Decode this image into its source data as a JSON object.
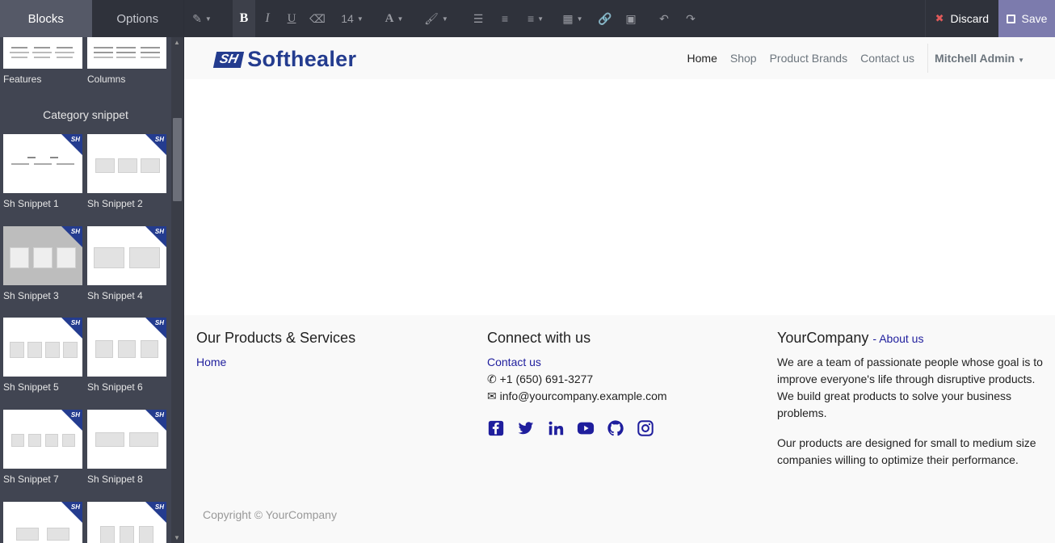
{
  "sidebar": {
    "tabs": [
      {
        "label": "Blocks"
      },
      {
        "label": "Options"
      }
    ],
    "top_items": [
      {
        "label": "Features"
      },
      {
        "label": "Columns"
      }
    ],
    "category_heading": "Category snippet",
    "snippets": [
      {
        "label": "Sh Snippet 1"
      },
      {
        "label": "Sh Snippet 2"
      },
      {
        "label": "Sh Snippet 3"
      },
      {
        "label": "Sh Snippet 4"
      },
      {
        "label": "Sh Snippet 5"
      },
      {
        "label": "Sh Snippet 6"
      },
      {
        "label": "Sh Snippet 7"
      },
      {
        "label": "Sh Snippet 8"
      }
    ]
  },
  "toolbar": {
    "font_size": "14",
    "discard_label": "Discard",
    "save_label": "Save",
    "icons": [
      "magic-wand-icon",
      "bold-icon",
      "italic-icon",
      "underline-icon",
      "eraser-icon",
      "font-size-select",
      "font-color-icon",
      "highlight-brush-icon",
      "bullet-list-icon",
      "numbered-list-icon",
      "align-icon",
      "table-icon",
      "link-icon",
      "image-icon",
      "undo-icon",
      "redo-icon"
    ]
  },
  "navbar": {
    "logo_mark": "SH",
    "logo_text": "Softhealer",
    "links": [
      {
        "label": "Home"
      },
      {
        "label": "Shop"
      },
      {
        "label": "Product Brands"
      },
      {
        "label": "Contact us"
      }
    ],
    "user": "Mitchell Admin"
  },
  "footer": {
    "col1": {
      "title": "Our Products & Services",
      "link": "Home"
    },
    "col2": {
      "title": "Connect with us",
      "contact": "Contact us",
      "phone": "+1 (650) 691-3277",
      "email": "info@yourcompany.example.com",
      "social": [
        "facebook-icon",
        "twitter-icon",
        "linkedin-icon",
        "youtube-icon",
        "github-icon",
        "instagram-icon"
      ]
    },
    "col3": {
      "title": "YourCompany",
      "about": "- About us",
      "p1": "We are a team of passionate people whose goal is to improve everyone's life through disruptive products. We build great products to solve your business problems.",
      "p2": "Our products are designed for small to medium size companies willing to optimize their performance."
    },
    "copyright": "Copyright © YourCompany"
  },
  "colors": {
    "brand": "#243c8f",
    "link": "#1f1e9d",
    "save": "#7c7bad",
    "sidebar": "#414552"
  }
}
